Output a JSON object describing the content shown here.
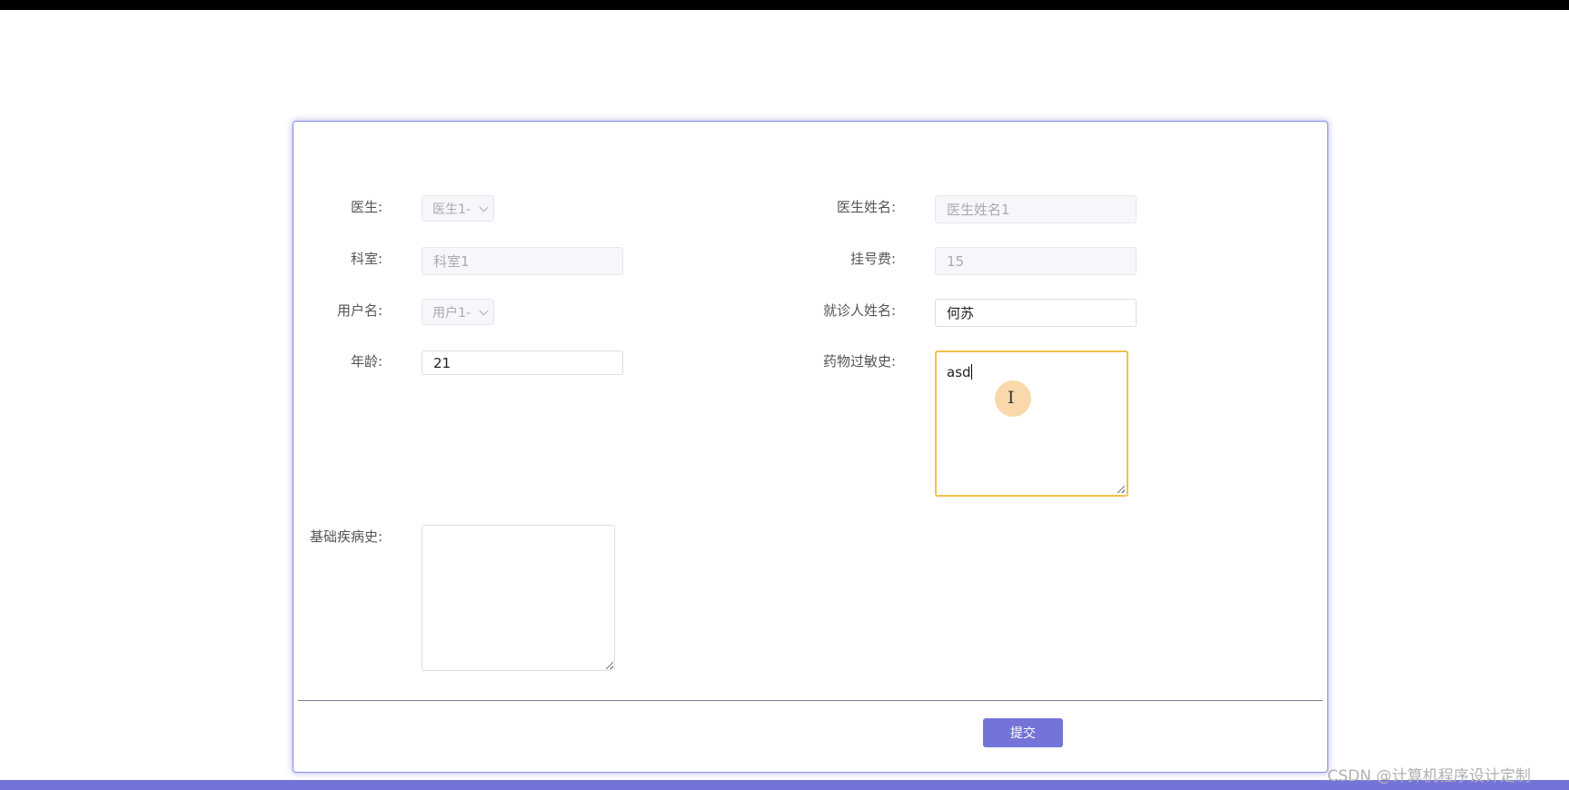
{
  "form": {
    "doctor": {
      "label": "医生:",
      "value": "医生1-:"
    },
    "doctor_name": {
      "label": "医生姓名:",
      "value": "医生姓名1"
    },
    "department": {
      "label": "科室:",
      "value": "科室1"
    },
    "registration_fee": {
      "label": "挂号费:",
      "value": "15"
    },
    "username": {
      "label": "用户名:",
      "value": "用户1-:"
    },
    "patient_name": {
      "label": "就诊人姓名:",
      "value": "何苏"
    },
    "age": {
      "label": "年龄:",
      "value": "21"
    },
    "drug_allergy": {
      "label": "药物过敏史:",
      "value": "asd"
    },
    "medical_history": {
      "label": "基础疾病史:",
      "value": ""
    }
  },
  "actions": {
    "submit_label": "提交"
  },
  "watermark": "CSDN @计算机程序设计定制",
  "colors": {
    "accent": "#7474d8",
    "focus_border": "#f2c14c",
    "top_bar": "#000000"
  }
}
